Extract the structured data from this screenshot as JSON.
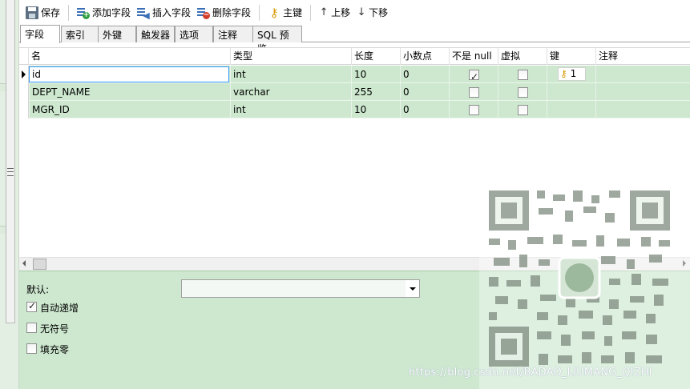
{
  "toolbar": {
    "save": "保存",
    "add_field": "添加字段",
    "insert_field": "插入字段",
    "delete_field": "删除字段",
    "primary_key": "主键",
    "move_up": "上移",
    "move_down": "下移"
  },
  "tabs": [
    "字段",
    "索引",
    "外键",
    "触发器",
    "选项",
    "注释",
    "SQL 预览"
  ],
  "active_tab": "字段",
  "columns": [
    "名",
    "类型",
    "长度",
    "小数点",
    "不是 null",
    "虚拟",
    "键",
    "注释"
  ],
  "rows": [
    {
      "name": "id",
      "type": "int",
      "length": "10",
      "decimals": "0",
      "not_null": true,
      "virtual": false,
      "key": "1",
      "comment": ""
    },
    {
      "name": "DEPT_NAME",
      "type": "varchar",
      "length": "255",
      "decimals": "0",
      "not_null": false,
      "virtual": false,
      "key": "",
      "comment": ""
    },
    {
      "name": "MGR_ID",
      "type": "int",
      "length": "10",
      "decimals": "0",
      "not_null": false,
      "virtual": false,
      "key": "",
      "comment": ""
    }
  ],
  "properties": {
    "default_label": "默认:",
    "default_value": "",
    "auto_increment_label": "自动递增",
    "auto_increment": true,
    "unsigned_label": "无符号",
    "unsigned": false,
    "zerofill_label": "填充零",
    "zerofill": false
  },
  "watermark": "https://blog.csdn.net/BADAO_LIUMANG_QIZHI",
  "colors": {
    "row_bg": "#cde8cf",
    "selection_border": "#3399ff",
    "key_icon": "#d89a00"
  }
}
